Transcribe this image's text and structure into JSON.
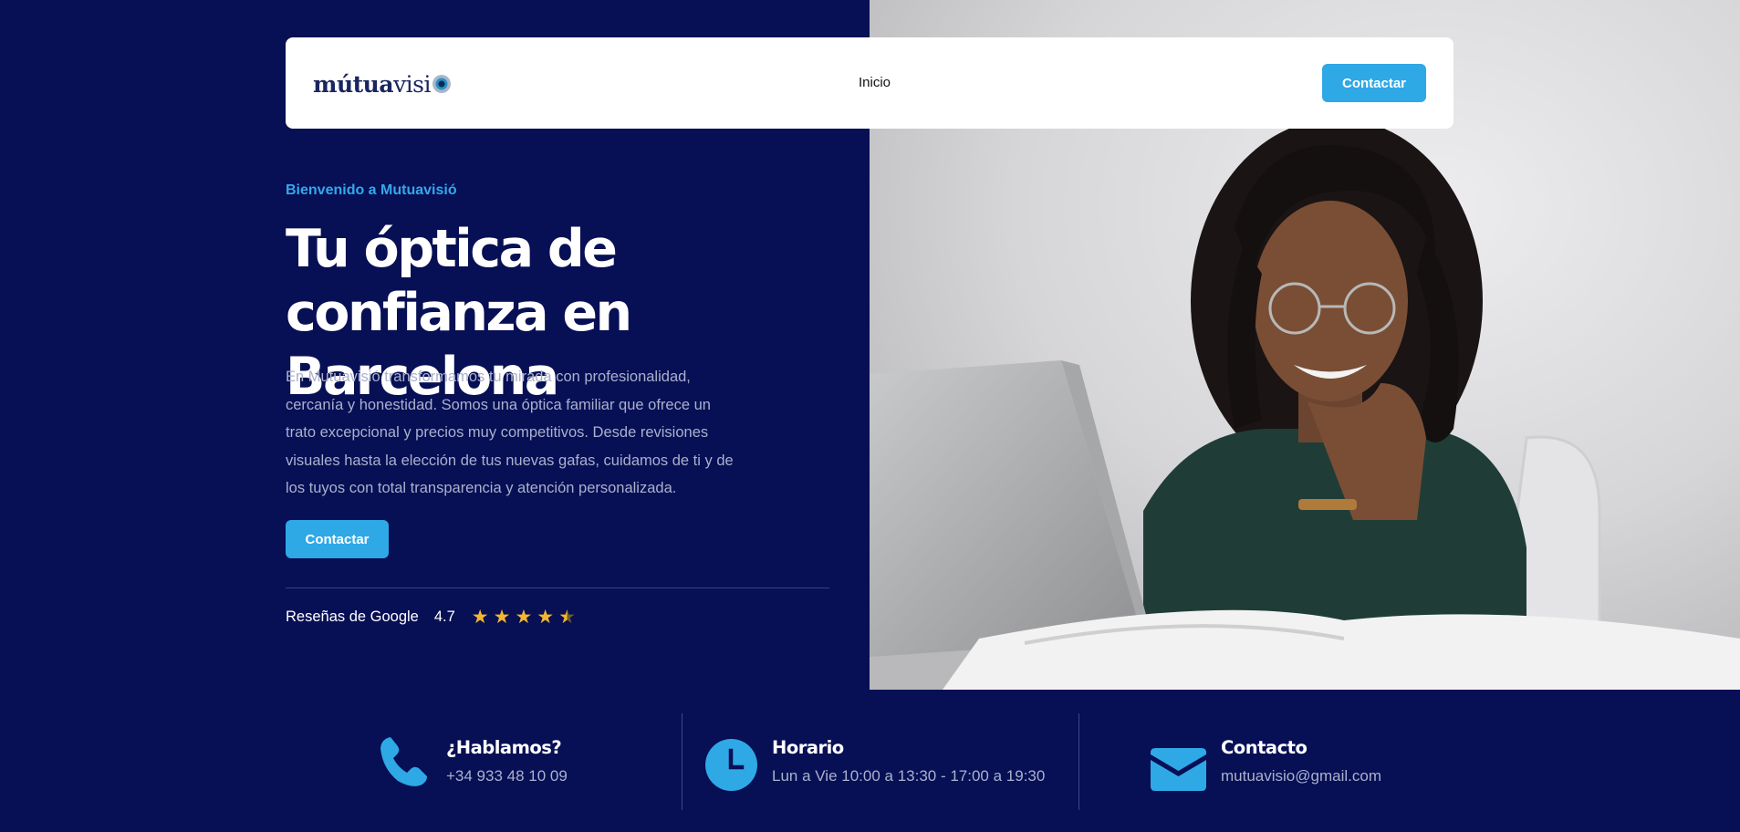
{
  "header": {
    "logo": "mútuavisió",
    "nav": [
      {
        "label": "Inicio"
      }
    ],
    "cta_label": "Contactar"
  },
  "hero": {
    "eyebrow": "Bienvenido a Mutuavisió",
    "title": "Tu óptica de confianza en Barcelona",
    "description": "En Mutuavisió transformamos tu mirada con profesionalidad, cercanía y honestidad. Somos una óptica familiar que ofrece un trato excepcional y precios muy competitivos. Desde revisiones visuales hasta la elección de tus nuevas gafas, cuidamos de ti y de los tuyos con total transparencia y atención personalizada.",
    "cta_label": "Contactar",
    "reviews_label": "Reseñas de Google",
    "rating": "4.7",
    "stars": 4.5
  },
  "info": [
    {
      "icon": "phone-icon",
      "title": "¿Hablamos?",
      "text": "+34 933 48 10 09"
    },
    {
      "icon": "clock-icon",
      "title": "Horario",
      "text": "Lun a Vie 10:00 a 13:30 - 17:00 a 19:30"
    },
    {
      "icon": "envelope-icon",
      "title": "Contacto",
      "text": "mutuavisio@gmail.com"
    }
  ],
  "colors": {
    "background": "#070f55",
    "accent": "#2fa8e6",
    "star": "#f5b62e"
  }
}
